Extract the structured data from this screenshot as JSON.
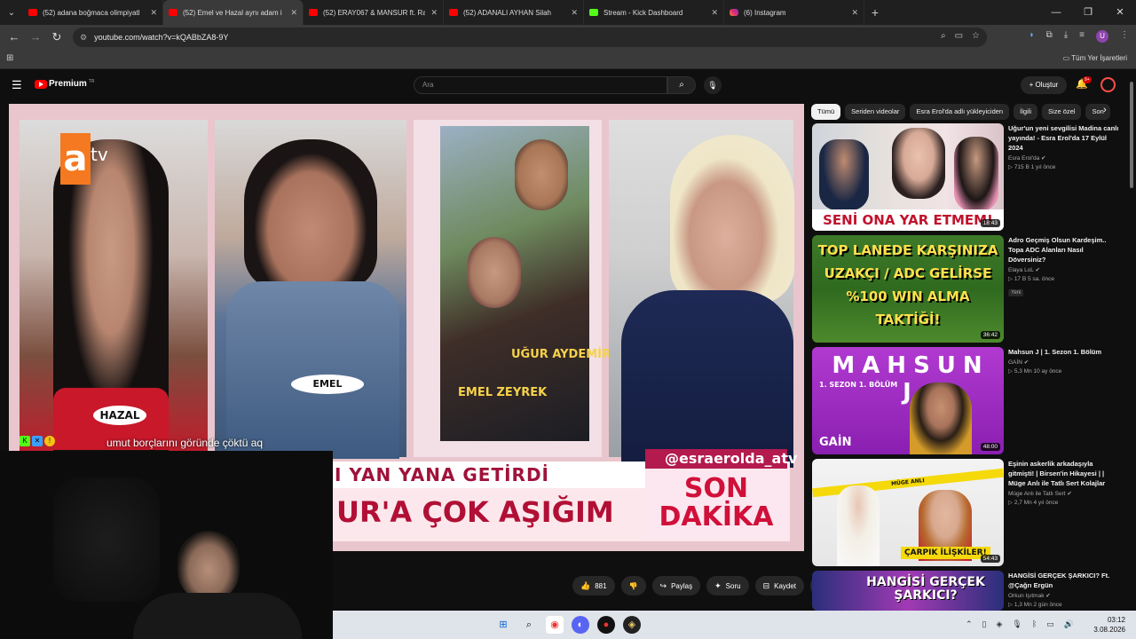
{
  "browser": {
    "tabs": [
      {
        "title": "(52) adana boğmaca olimpiyatl",
        "type": "yt"
      },
      {
        "title": "(52) Emel ve Hazal aynı adam i",
        "type": "yt",
        "active": true
      },
      {
        "title": "(52) ERAY067 & MANSUR ft. Ra",
        "type": "yt"
      },
      {
        "title": "(52) ADANALI AYHAN Silah",
        "type": "yt"
      },
      {
        "title": "Stream - Kick Dashboard",
        "type": "kick"
      },
      {
        "title": "(6) Instagram",
        "type": "ig"
      }
    ],
    "new_tab": "+",
    "url": "youtube.com/watch?v=kQABbZA8-9Y",
    "bookmarks_all": "Tüm Yer İşaretleri",
    "profile_initial": "U"
  },
  "youtube": {
    "brand": "Premium",
    "brand_region": "TR",
    "search_placeholder": "Ara",
    "create_label": "Oluştur",
    "notif_badge": "9+"
  },
  "video": {
    "channel_logo_a": "a",
    "channel_logo_tv": "tv",
    "subtitle": "umut borçlarını göründe çöktü aq",
    "name_tag_1": "HAZAL",
    "name_tag_2": "EMEL",
    "photo_name_1": "UĞUR AYDEMİR",
    "photo_name_2": "EMEL ZEYREK",
    "lower_third_top": "I YAN YANA GETİRDİ",
    "lower_third_main": "UR'A ÇOK AŞIĞIM",
    "instagram_handle": "@esraerolda_atv",
    "breaking_line1": "SON",
    "breaking_line2": "DAKİKA"
  },
  "actions": {
    "like_count": "881",
    "share": "Paylaş",
    "ask": "Soru",
    "save": "Kaydet"
  },
  "chips": [
    "Tümü",
    "Seriden videolar",
    "Esra Erol'da adlı yükleyiciden",
    "İlgili",
    "Size özel",
    "Son"
  ],
  "recommendations": [
    {
      "title": "Uğur'un yeni sevgilisi Madina canlı yayında! - Esra Erol'da 17 Eylül 2024",
      "channel": "Esra Erol'da",
      "stats": "715 B  1 yıl önce",
      "duration": "18:43",
      "thumb_text": "SENİ ONA YAR ETMEM!"
    },
    {
      "title": "Adro Geçmiş Olsun Kardeşim.. Topa ADC Alanları Nasıl Döversiniz?",
      "channel": "Elaya LoL",
      "stats": "17 B  5 sa. önce",
      "duration": "36:42",
      "thumb_text": "TOP LANEDE KARŞINIZA UZAKÇI / ADC GELİRSE %100 WIN ALMA TAKTİĞİ!",
      "badge": "Yeni"
    },
    {
      "title": "Mahsun J | 1. Sezon 1. Bölüm",
      "channel": "GAİN",
      "stats": "5,3 Mn  10 ay önce",
      "duration": "48:00",
      "thumb_text": "MAHSUN J",
      "thumb_sub": "1. SEZON 1. BÖLÜM",
      "thumb_logo": "GAİN"
    },
    {
      "title": "Eşinin askerlik arkadaşıyla gitmişti! | Birsen'in Hikayesi | | Müge Anlı ile Tatlı Sert Kolajlar",
      "channel": "Müge Anlı ile Tatlı Sert",
      "stats": "2,7 Mn  4 yıl önce",
      "duration": "54:43",
      "thumb_text": "ÇARPIK İLİŞKİLER!",
      "thumb_banner": "MÜGE ANLI"
    },
    {
      "title": "HANGİSİ GERÇEK ŞARKICI? Ft. @Çağrı Ergün",
      "channel": "Orkun Işıtmak",
      "stats": "1,3 Mn  2 gün önce",
      "duration": "",
      "thumb_text": "HANGİSİ GERÇEK ŞARKICI?"
    }
  ],
  "taskbar": {
    "time": "03:12",
    "date": "3.08.2026"
  },
  "colors": {
    "yt_red": "#ff0000",
    "bg": "#0f0f0f",
    "chip": "#272727",
    "atv_orange": "#f47920"
  }
}
